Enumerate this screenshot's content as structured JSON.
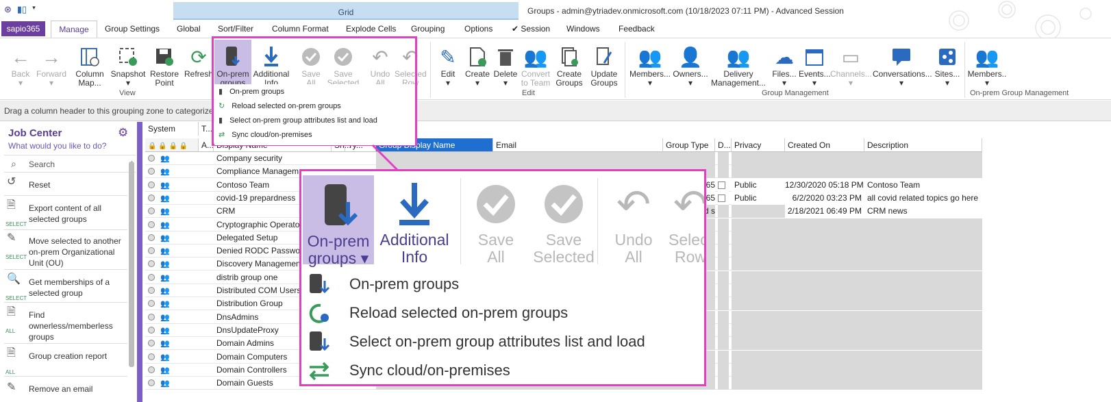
{
  "window": {
    "title": "Groups - admin@ytriadev.onmicrosoft.com (10/18/2023 07:11 PM) - Advanced Session",
    "context_tab": "Grid"
  },
  "tabs": {
    "brand": "sapio365",
    "active": "Manage",
    "items": [
      "Group Settings",
      "Global",
      "Sort/Filter",
      "Column Format",
      "Explode Cells",
      "Grouping",
      "Options",
      "✔ Session",
      "Windows",
      "Feedback"
    ]
  },
  "ribbon": {
    "buttons": [
      {
        "label1": "Back",
        "label2": "",
        "icon": "arrow-left-icon",
        "disabled": true
      },
      {
        "label1": "Forward",
        "label2": "",
        "icon": "arrow-right-icon",
        "disabled": true
      },
      {
        "label1": "Column",
        "label2": "Map...",
        "icon": "column-map-icon",
        "disabled": false
      },
      {
        "label1": "Snapshot",
        "label2": "",
        "icon": "snapshot-icon",
        "disabled": false
      },
      {
        "label1": "Restore",
        "label2": "Point",
        "icon": "save-icon",
        "disabled": false
      },
      {
        "label1": "Refresh",
        "label2": "",
        "icon": "refresh-icon",
        "disabled": false
      },
      {
        "label1": "On-prem",
        "label2": "groups",
        "icon": "server-icon",
        "disabled": false
      },
      {
        "label1": "Additional",
        "label2": "Info",
        "icon": "download-icon",
        "disabled": false
      },
      {
        "label1": "Save",
        "label2": "All",
        "icon": "check-circle-icon",
        "disabled": true
      },
      {
        "label1": "Save",
        "label2": "Selected",
        "icon": "check-circle-icon",
        "disabled": true
      },
      {
        "label1": "Undo",
        "label2": "All",
        "icon": "undo-icon",
        "disabled": true
      },
      {
        "label1": "Selected",
        "label2": "Row",
        "icon": "undo-icon",
        "disabled": true
      },
      {
        "label1": "Edit",
        "label2": "",
        "icon": "pencil-icon",
        "disabled": false
      },
      {
        "label1": "Create",
        "label2": "",
        "icon": "create-icon",
        "disabled": false
      },
      {
        "label1": "Delete",
        "label2": "",
        "icon": "trash-icon",
        "disabled": false
      },
      {
        "label1": "Convert",
        "label2": "to Team",
        "icon": "teams-icon",
        "disabled": true
      },
      {
        "label1": "Create",
        "label2": "Groups",
        "icon": "create-groups-icon",
        "disabled": false
      },
      {
        "label1": "Update",
        "label2": "Groups",
        "icon": "update-groups-icon",
        "disabled": false
      },
      {
        "label1": "Members...",
        "label2": "",
        "icon": "members-icon",
        "disabled": false
      },
      {
        "label1": "Owners...",
        "label2": "",
        "icon": "owners-icon",
        "disabled": false
      },
      {
        "label1": "Delivery",
        "label2": "Management...",
        "icon": "delivery-icon",
        "disabled": false
      },
      {
        "label1": "Files...",
        "label2": "",
        "icon": "files-icon",
        "disabled": false
      },
      {
        "label1": "Events...",
        "label2": "",
        "icon": "calendar-icon",
        "disabled": false
      },
      {
        "label1": "Channels...",
        "label2": "",
        "icon": "channels-icon",
        "disabled": true
      },
      {
        "label1": "Conversations...",
        "label2": "",
        "icon": "chat-icon",
        "disabled": false
      },
      {
        "label1": "Sites...",
        "label2": "",
        "icon": "sites-icon",
        "disabled": false
      },
      {
        "label1": "Members..",
        "label2": "",
        "icon": "members-icon",
        "disabled": false
      }
    ],
    "group_labels": {
      "view": "View",
      "edit": "Edit",
      "group_mgmt": "Group Management",
      "onprem_mgmt": "On-prem Group Management"
    }
  },
  "dropdown": {
    "items": [
      "On-prem groups",
      "Reload selected on-prem groups",
      "Select on-prem group attributes list and load",
      "Sync cloud/on-premises"
    ]
  },
  "grouping_zone": "Drag a column header to this grouping zone to categorize y",
  "job_center": {
    "title": "Job Center",
    "subtitle": "What would you like to do?",
    "search": "Search",
    "reset": "Reset",
    "items": [
      {
        "text": "Export content of all selected groups",
        "tag": "SELECT"
      },
      {
        "text": "Move selected to another on-prem Organizational Unit (OU)",
        "tag": "SELECT"
      },
      {
        "text": "Get memberships of a selected group",
        "tag": "SELECT"
      },
      {
        "text": "Find ownerless/memberless groups",
        "tag": "ALL"
      },
      {
        "text": "Group creation report",
        "tag": "ALL"
      },
      {
        "text": "Remove an email",
        "tag": ""
      }
    ]
  },
  "grid": {
    "top_headers": [
      "System",
      "T..."
    ],
    "headers": [
      "A...",
      "Display Name",
      "Sh...",
      "Ty...",
      "Group Display Name",
      "Email",
      "Group Type",
      "D...",
      "Privacy",
      "Created On",
      "Description"
    ],
    "rows": [
      {
        "name": "Company security",
        "privacy": "",
        "created": "",
        "desc": ""
      },
      {
        "name": "Compliance Managem",
        "privacy": "",
        "created": "",
        "desc": ""
      },
      {
        "name": "Contoso Team",
        "privacy": "Public",
        "created": "12/30/2020 05:18 PM",
        "desc": "Contoso Team",
        "gt": "65"
      },
      {
        "name": "covid-19 prepardness",
        "privacy": "Public",
        "created": "6/2/2020 03:23 PM",
        "desc": "all covid related topics go here",
        "gt": "65"
      },
      {
        "name": "CRM",
        "privacy": "",
        "created": "2/18/2021 06:49 PM",
        "desc": "CRM news",
        "gt": "d s"
      },
      {
        "name": "Cryptographic Operato",
        "privacy": "",
        "created": "",
        "desc": ""
      },
      {
        "name": "Delegated Setup",
        "privacy": "",
        "created": "",
        "desc": ""
      },
      {
        "name": "Denied RODC Passwor",
        "privacy": "",
        "created": "",
        "desc": ""
      },
      {
        "name": "Discovery Managemen",
        "privacy": "",
        "created": "",
        "desc": ""
      },
      {
        "name": "distrib group one",
        "privacy": "",
        "created": "",
        "desc": ""
      },
      {
        "name": "Distributed COM Users",
        "privacy": "",
        "created": "",
        "desc": ""
      },
      {
        "name": "Distribution Group",
        "privacy": "",
        "created": "",
        "desc": ""
      },
      {
        "name": "DnsAdmins",
        "privacy": "",
        "created": "",
        "desc": ""
      },
      {
        "name": "DnsUpdateProxy",
        "privacy": "",
        "created": "",
        "desc": ""
      },
      {
        "name": "Domain Admins",
        "privacy": "",
        "created": "",
        "desc": ""
      },
      {
        "name": "Domain Computers",
        "privacy": "",
        "created": "",
        "desc": ""
      },
      {
        "name": "Domain Controllers",
        "privacy": "",
        "created": "",
        "desc": ""
      },
      {
        "name": "Domain Guests",
        "privacy": "",
        "created": "",
        "desc": ""
      }
    ]
  },
  "zoom": {
    "buttons": [
      {
        "l1": "On-prem",
        "l2": "groups ▾",
        "disabled": false
      },
      {
        "l1": "Additional",
        "l2": "Info",
        "disabled": false
      },
      {
        "l1": "Save",
        "l2": "All",
        "disabled": true
      },
      {
        "l1": "Save",
        "l2": "Selected",
        "disabled": true
      },
      {
        "l1": "Undo",
        "l2": "All",
        "disabled": true
      },
      {
        "l1": "Select",
        "l2": "Row",
        "disabled": true
      }
    ]
  },
  "colors": {
    "accent": "#5a3d96",
    "highlight": "#e33fc3",
    "selected_btn": "#c9bde6"
  }
}
